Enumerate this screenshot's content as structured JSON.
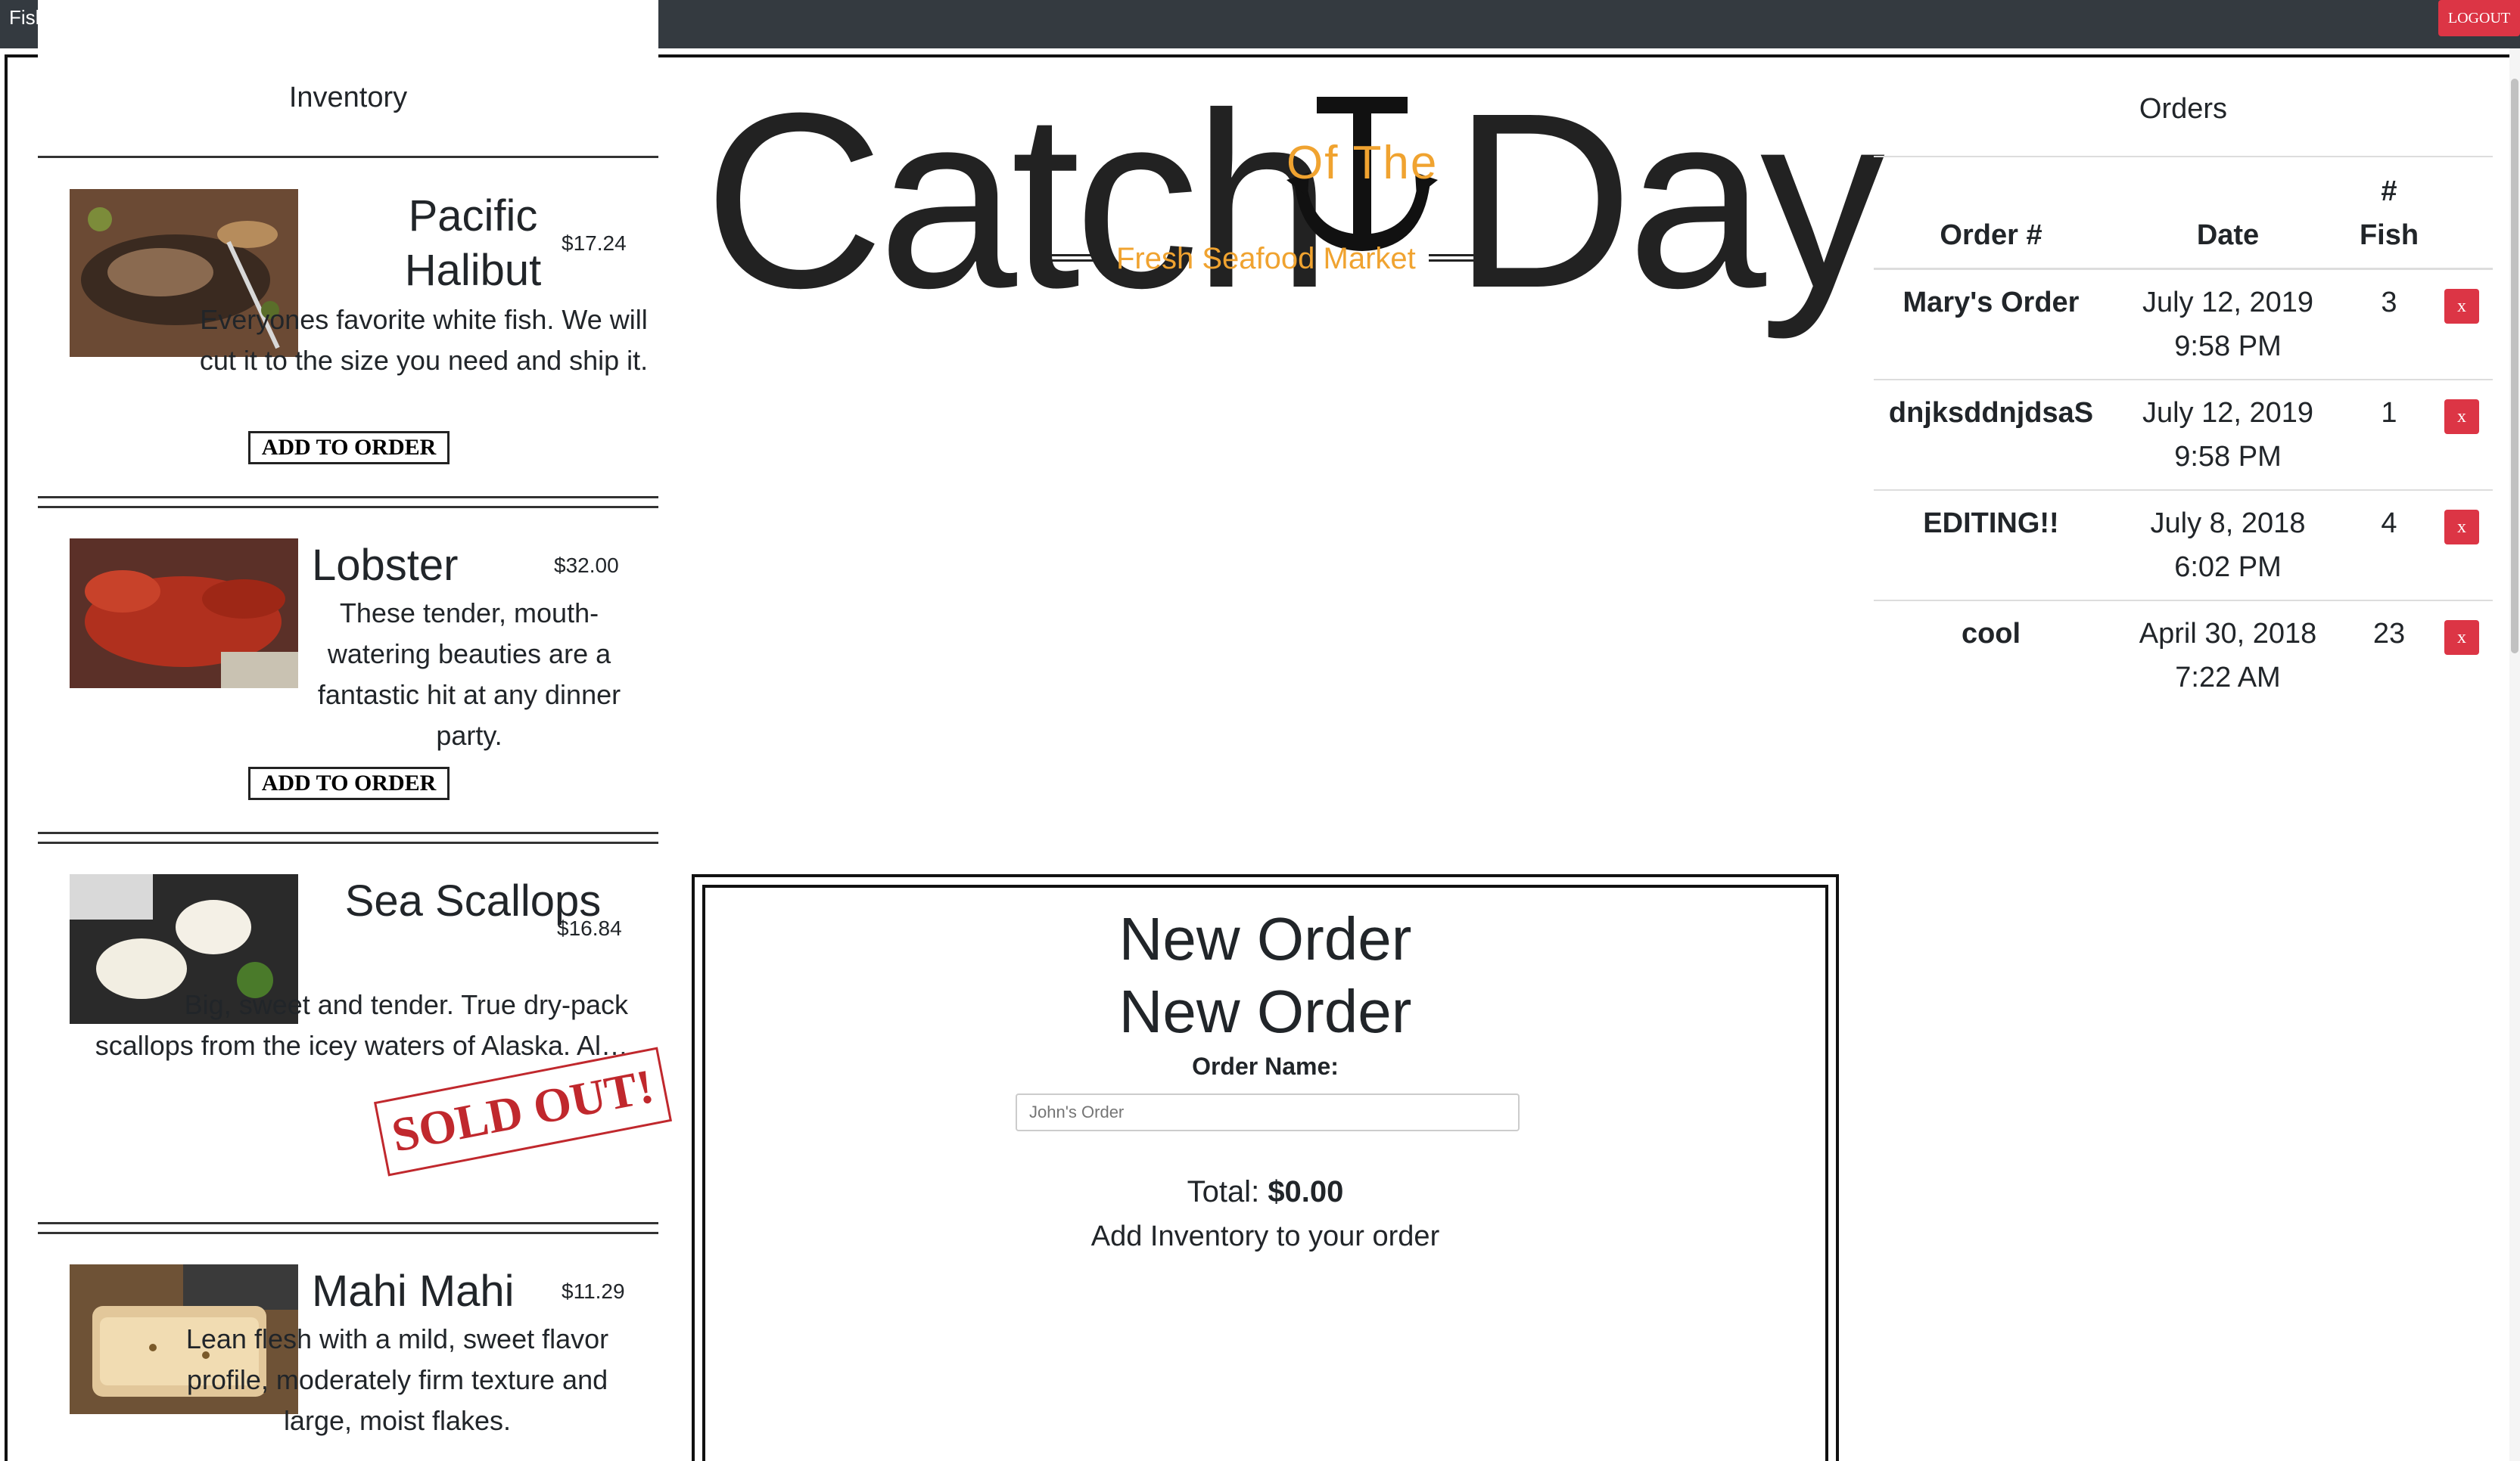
{
  "navbar": {
    "brand": "Fish Store",
    "logout_label": "LOGOUT"
  },
  "inventory": {
    "title": "Inventory",
    "items": [
      {
        "name": "Pacific Halibut",
        "price": "$17.24",
        "desc": "Everyones favorite white fish. We will cut it to the size you need and ship it.",
        "button": "ADD TO ORDER",
        "image": "grilled-halibut-image"
      },
      {
        "name": "Lobster",
        "price": "$32.00",
        "desc": "These tender, mouth-watering beauties are a fantastic hit at any dinner party.",
        "button": "ADD TO ORDER",
        "image": "lobster-image"
      },
      {
        "name": "Sea Scallops",
        "price": "$16.84",
        "desc": "Big, sweet and tender. True dry-pack scallops from the icey waters of Alaska. Al… per p…",
        "sold_out": "SOLD OUT!",
        "image": "scallops-image"
      },
      {
        "name": "Mahi Mahi",
        "price": "$11.29",
        "desc": "Lean flesh with a mild, sweet flavor profile, moderately firm texture and large, moist flakes.",
        "image": "mahi-mahi-image"
      }
    ]
  },
  "logo": {
    "left": "Catch",
    "middle": "Of The",
    "right": "Day",
    "tagline": "Fresh Seafood Market",
    "accent_color": "#f0a330"
  },
  "new_order": {
    "title1": "New Order",
    "title2": "New Order",
    "name_label": "Order Name:",
    "name_placeholder": "John's Order",
    "total_label": "Total:",
    "total_value": "$0.00",
    "hint": "Add Inventory to your order"
  },
  "orders": {
    "title": "Orders",
    "columns": [
      "Order #",
      "Date",
      "#\nFish"
    ],
    "rows": [
      {
        "name": "Mary's Order",
        "date": "July 12, 2019",
        "time": "9:58 PM",
        "count": "3",
        "delete": "x"
      },
      {
        "name": "dnjksddnjdsaS",
        "date": "July 12, 2019",
        "time": "9:58 PM",
        "count": "1",
        "delete": "x"
      },
      {
        "name": "EDITING!!",
        "date": "July 8, 2018",
        "time": "6:02 PM",
        "count": "4",
        "delete": "x"
      },
      {
        "name": "cool",
        "date": "April 30, 2018",
        "time": "7:22 AM",
        "count": "23",
        "delete": "x"
      }
    ]
  }
}
